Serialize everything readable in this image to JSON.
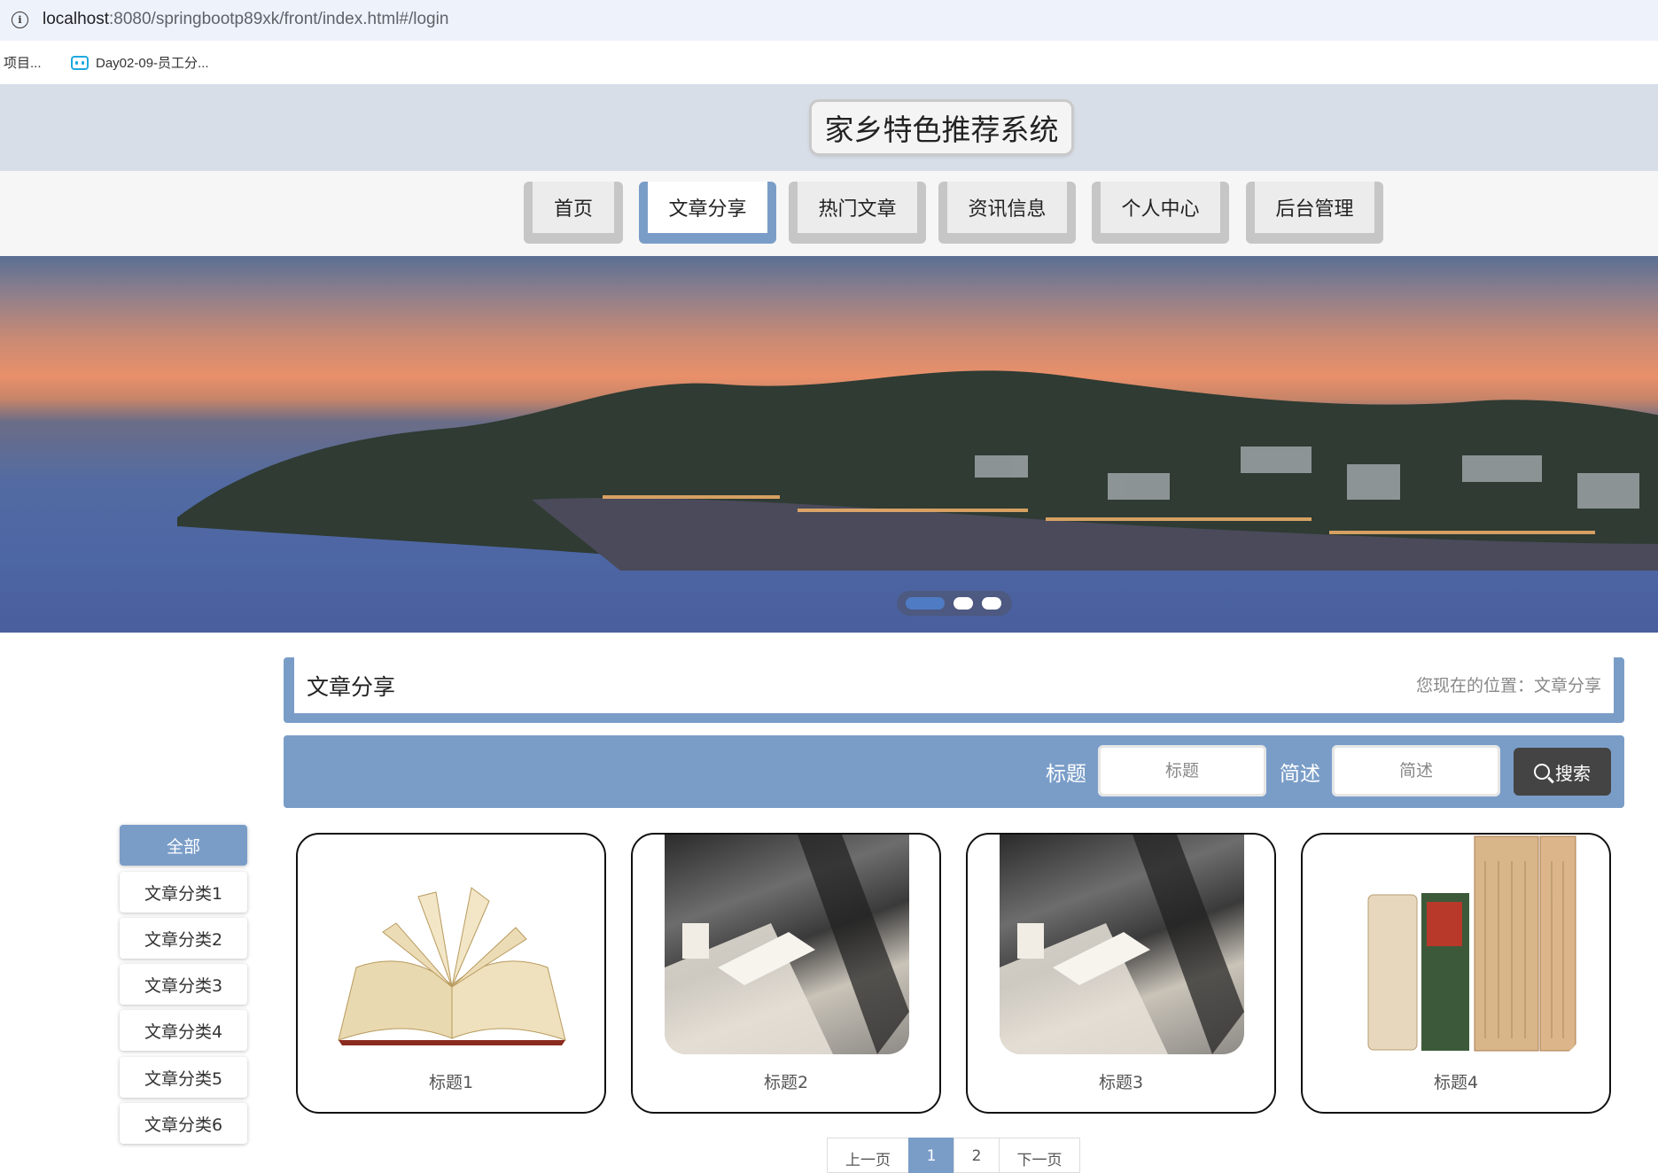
{
  "browser": {
    "url_host": "localhost",
    "url_rest": ":8080/springbootp89xk/front/index.html#/login",
    "bookmarks": [
      "项目...",
      "Day02-09-员工分..."
    ]
  },
  "site": {
    "title": "家乡特色推荐系统"
  },
  "nav": {
    "items": [
      "首页",
      "文章分享",
      "热门文章",
      "资讯信息",
      "个人中心",
      "后台管理"
    ],
    "active_index": 1,
    "active_color": "#7a9dc8"
  },
  "banner": {
    "slides": 3,
    "active_slide": 0
  },
  "breadcrumb": {
    "title": "文章分享",
    "location": "您现在的位置：文章分享"
  },
  "search": {
    "title_label": "标题",
    "title_placeholder": "标题",
    "desc_label": "简述",
    "desc_placeholder": "简述",
    "button_label": "搜索"
  },
  "categories": {
    "items": [
      "全部",
      "文章分类1",
      "文章分类2",
      "文章分类3",
      "文章分类4",
      "文章分类5",
      "文章分类6"
    ],
    "active_index": 0
  },
  "articles": [
    {
      "title": "标题1",
      "image": "open-book-image"
    },
    {
      "title": "标题2",
      "image": "museum-display-image"
    },
    {
      "title": "标题3",
      "image": "museum-display-image"
    },
    {
      "title": "标题4",
      "image": "old-books-image"
    }
  ],
  "pagination": {
    "prev": "上一页",
    "pages": [
      "1",
      "2"
    ],
    "current": "1",
    "next": "下一页"
  }
}
